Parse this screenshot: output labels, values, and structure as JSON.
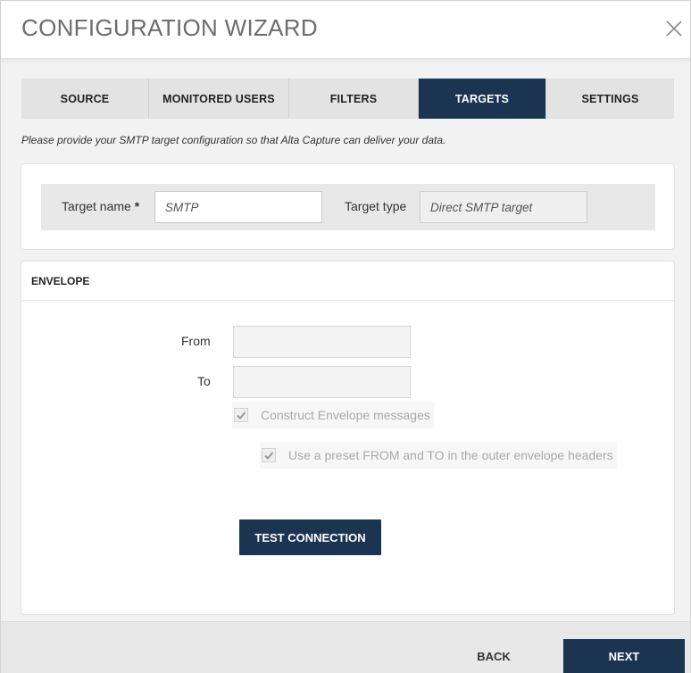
{
  "window": {
    "title": "CONFIGURATION WIZARD"
  },
  "tabs": [
    {
      "label": "SOURCE",
      "active": false
    },
    {
      "label": "MONITORED USERS",
      "active": false
    },
    {
      "label": "FILTERS",
      "active": false
    },
    {
      "label": "TARGETS",
      "active": true
    },
    {
      "label": "SETTINGS",
      "active": false
    }
  ],
  "instructions": "Please provide your SMTP target configuration so that Alta Capture can deliver your data.",
  "target": {
    "name_label": "Target name",
    "required_mark": "*",
    "name_value": "SMTP",
    "type_label": "Target type",
    "type_value": "Direct SMTP target"
  },
  "envelope": {
    "heading": "ENVELOPE",
    "from_label": "From",
    "from_value": "",
    "to_label": "To",
    "to_value": "",
    "construct_label": "Construct Envelope messages",
    "construct_checked": true,
    "preset_label": "Use a preset FROM and TO in the outer envelope headers",
    "preset_checked": true,
    "test_button": "TEST CONNECTION"
  },
  "footer": {
    "back_label": "BACK",
    "next_label": "NEXT"
  },
  "colors": {
    "primary": "#1b3451",
    "tab_inactive": "#e3e3e3",
    "disabled_text": "#a9a9a9"
  }
}
